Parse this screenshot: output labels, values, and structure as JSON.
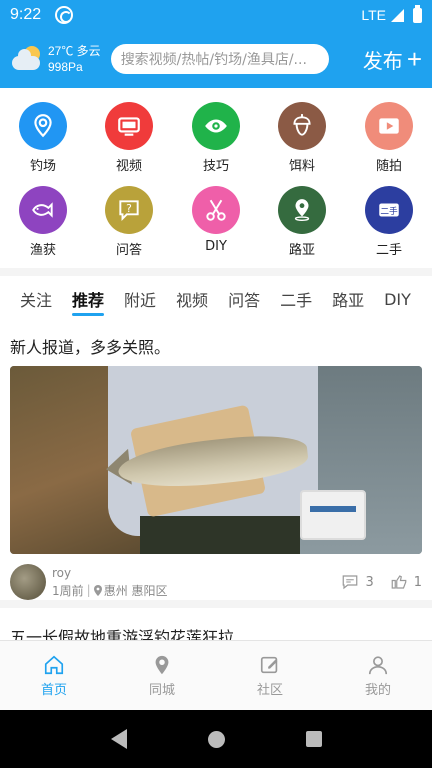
{
  "status_bar": {
    "time": "9:22",
    "network": "LTE"
  },
  "header": {
    "weather_temp": "27℃ 多云",
    "weather_pressure": "998Pa",
    "search_placeholder": "搜索视频/热帖/钓场/渔具店/...",
    "publish_label": "发布",
    "publish_plus": "+"
  },
  "categories": [
    {
      "label": "钓场",
      "icon": "location-pin-icon",
      "color": "#2196f3"
    },
    {
      "label": "视频",
      "icon": "tv-icon",
      "color": "#f03b3b"
    },
    {
      "label": "技巧",
      "icon": "eye-icon",
      "color": "#20b34a"
    },
    {
      "label": "饵料",
      "icon": "acorn-icon",
      "color": "#8b5a45"
    },
    {
      "label": "随拍",
      "icon": "play-icon",
      "color": "#f08c7a"
    },
    {
      "label": "渔获",
      "icon": "fish-icon",
      "color": "#8e44c0"
    },
    {
      "label": "问答",
      "icon": "question-icon",
      "color": "#b9a23a"
    },
    {
      "label": "DIY",
      "icon": "scissors-icon",
      "color": "#ef5fa9"
    },
    {
      "label": "路亚",
      "icon": "map-pin-icon",
      "color": "#356b3f"
    },
    {
      "label": "二手",
      "icon": "second-hand-icon",
      "color": "#2c3ea0",
      "badge": "二手"
    }
  ],
  "tabs": [
    {
      "label": "关注",
      "active": false
    },
    {
      "label": "推荐",
      "active": true
    },
    {
      "label": "附近",
      "active": false
    },
    {
      "label": "视频",
      "active": false
    },
    {
      "label": "问答",
      "active": false
    },
    {
      "label": "二手",
      "active": false
    },
    {
      "label": "路亚",
      "active": false
    },
    {
      "label": "DIY",
      "active": false
    }
  ],
  "post": {
    "title": "新人报道，多多关照。",
    "author": "roy",
    "time_ago": "1周前",
    "location": "惠州 惠阳区",
    "comments": "3",
    "likes": "1"
  },
  "post2": {
    "title": "五一长假故地重游浮钓花莲狂拉"
  },
  "bottom_nav": [
    {
      "label": "首页",
      "icon": "home-icon",
      "active": true
    },
    {
      "label": "同城",
      "icon": "location-icon",
      "active": false
    },
    {
      "label": "社区",
      "icon": "edit-icon",
      "active": false
    },
    {
      "label": "我的",
      "icon": "user-icon",
      "active": false
    }
  ],
  "colors": {
    "brand": "#1fa2ef"
  }
}
